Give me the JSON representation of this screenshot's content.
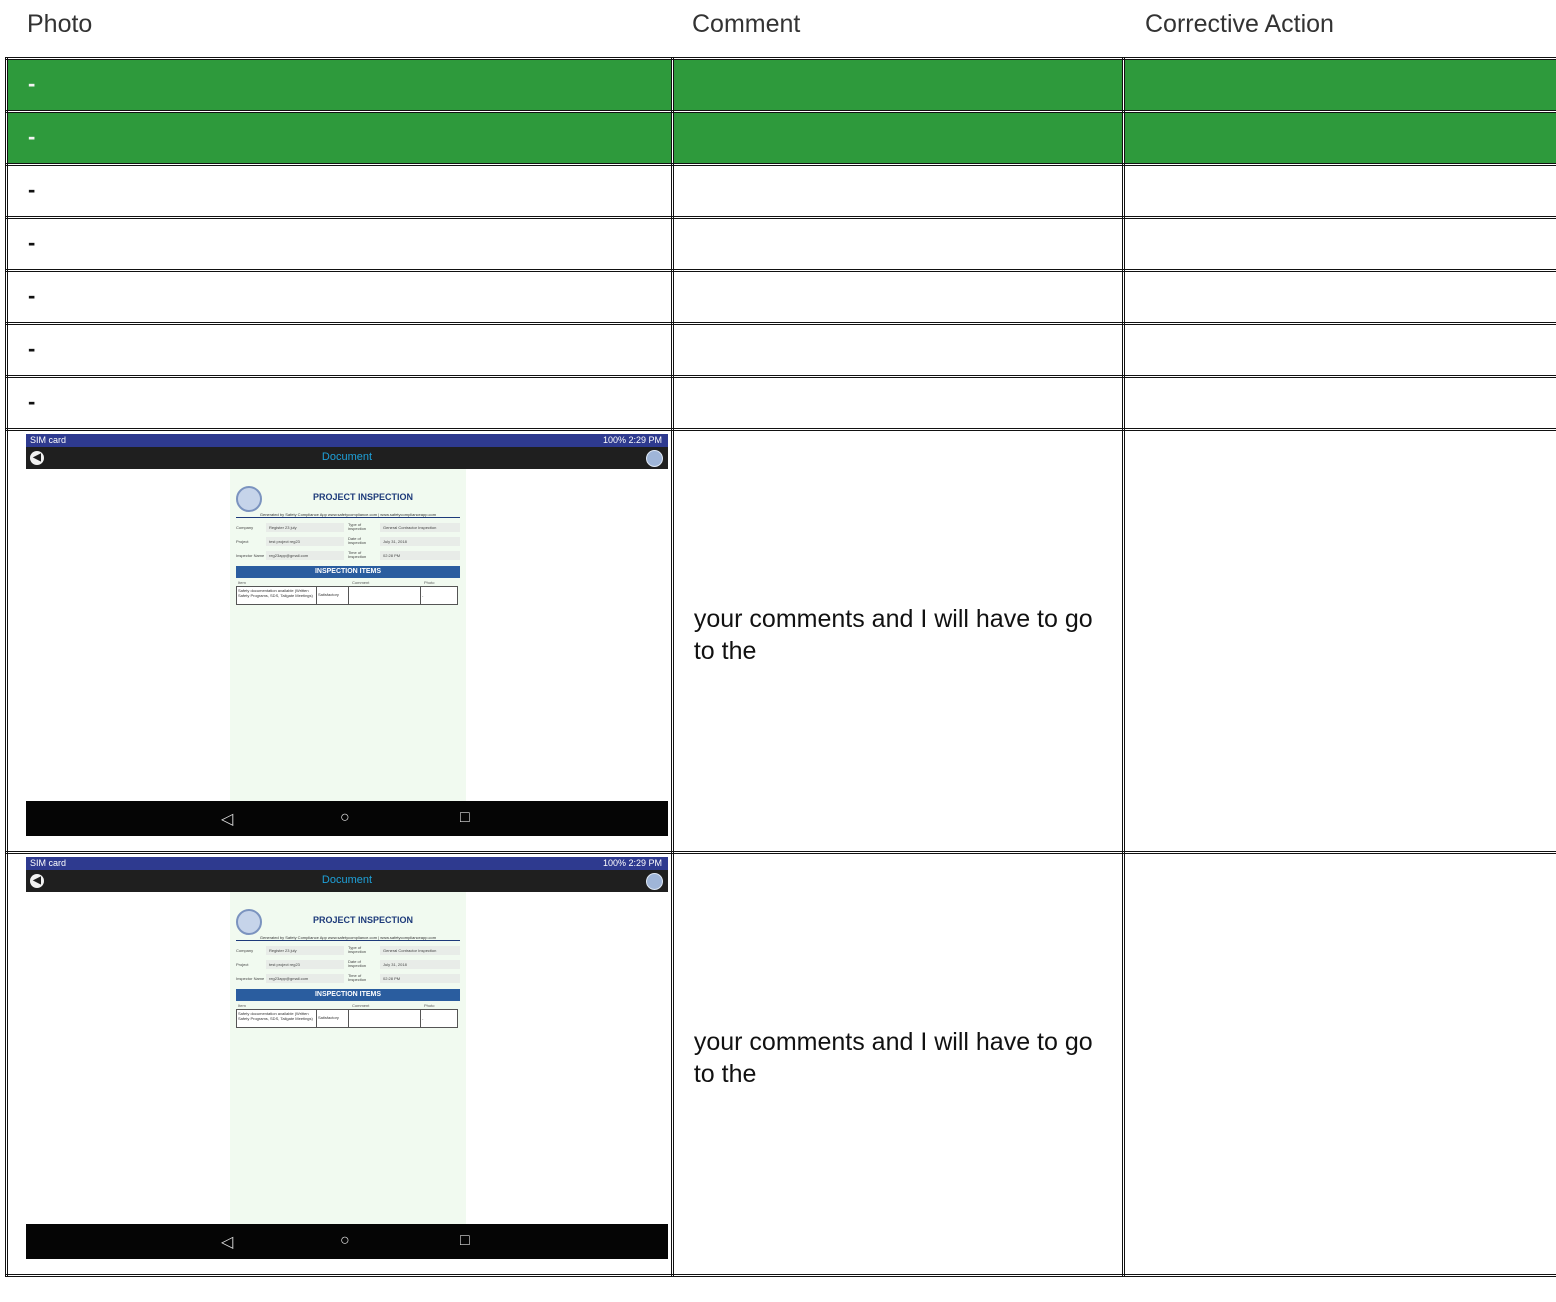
{
  "headers": {
    "photo": "Photo",
    "comment": "Comment",
    "corrective_action": "Corrective Action"
  },
  "rows": [
    {
      "type": "green",
      "photo": "-",
      "comment": "",
      "corrective_action": ""
    },
    {
      "type": "green",
      "photo": "-",
      "comment": "",
      "corrective_action": ""
    },
    {
      "type": "white",
      "photo": "-",
      "comment": "",
      "corrective_action": ""
    },
    {
      "type": "white",
      "photo": "-",
      "comment": "",
      "corrective_action": ""
    },
    {
      "type": "white",
      "photo": "-",
      "comment": "",
      "corrective_action": ""
    },
    {
      "type": "white",
      "photo": "-",
      "comment": "",
      "corrective_action": ""
    },
    {
      "type": "white",
      "photo": "-",
      "comment": "",
      "corrective_action": ""
    }
  ],
  "photo_rows": [
    {
      "comment": "your comments and I will have to go to the",
      "corrective_action": ""
    },
    {
      "comment": "your comments and I will have to go to the",
      "corrective_action": ""
    }
  ],
  "screenshot": {
    "status_left": "SIM card",
    "status_right": "100%  2:29 PM",
    "toolbar_title": "Document",
    "doc_title": "PROJECT INSPECTION",
    "generated_by": "Generated by Safety Compliance App www.safetycompliance.com | www.safetycomplianceapp.com",
    "fields": [
      {
        "k1": "Company",
        "v1": "Register 23 july",
        "k2": "Type of inspection",
        "v2": "General Contractor Inspection"
      },
      {
        "k1": "Project",
        "v1": "test project reg23",
        "k2": "Date of inspection",
        "v2": "July 31, 2018"
      },
      {
        "k1": "Inspector Name",
        "v1": "reg23app@gmail.com",
        "k2": "Time of Inspection",
        "v2": "02:28 PM"
      }
    ],
    "items_title": "INSPECTION ITEMS",
    "items_headers": {
      "item": "Item",
      "comment": "Comment",
      "photo": "Photo"
    },
    "item_row": {
      "item": "Safety documentation available (Written Safety Programs, SDS, Tailgate Meetings)",
      "status": "Satisfactory",
      "photo": "-"
    },
    "nav": {
      "back": "◁",
      "home": "○",
      "recent": "□"
    }
  }
}
